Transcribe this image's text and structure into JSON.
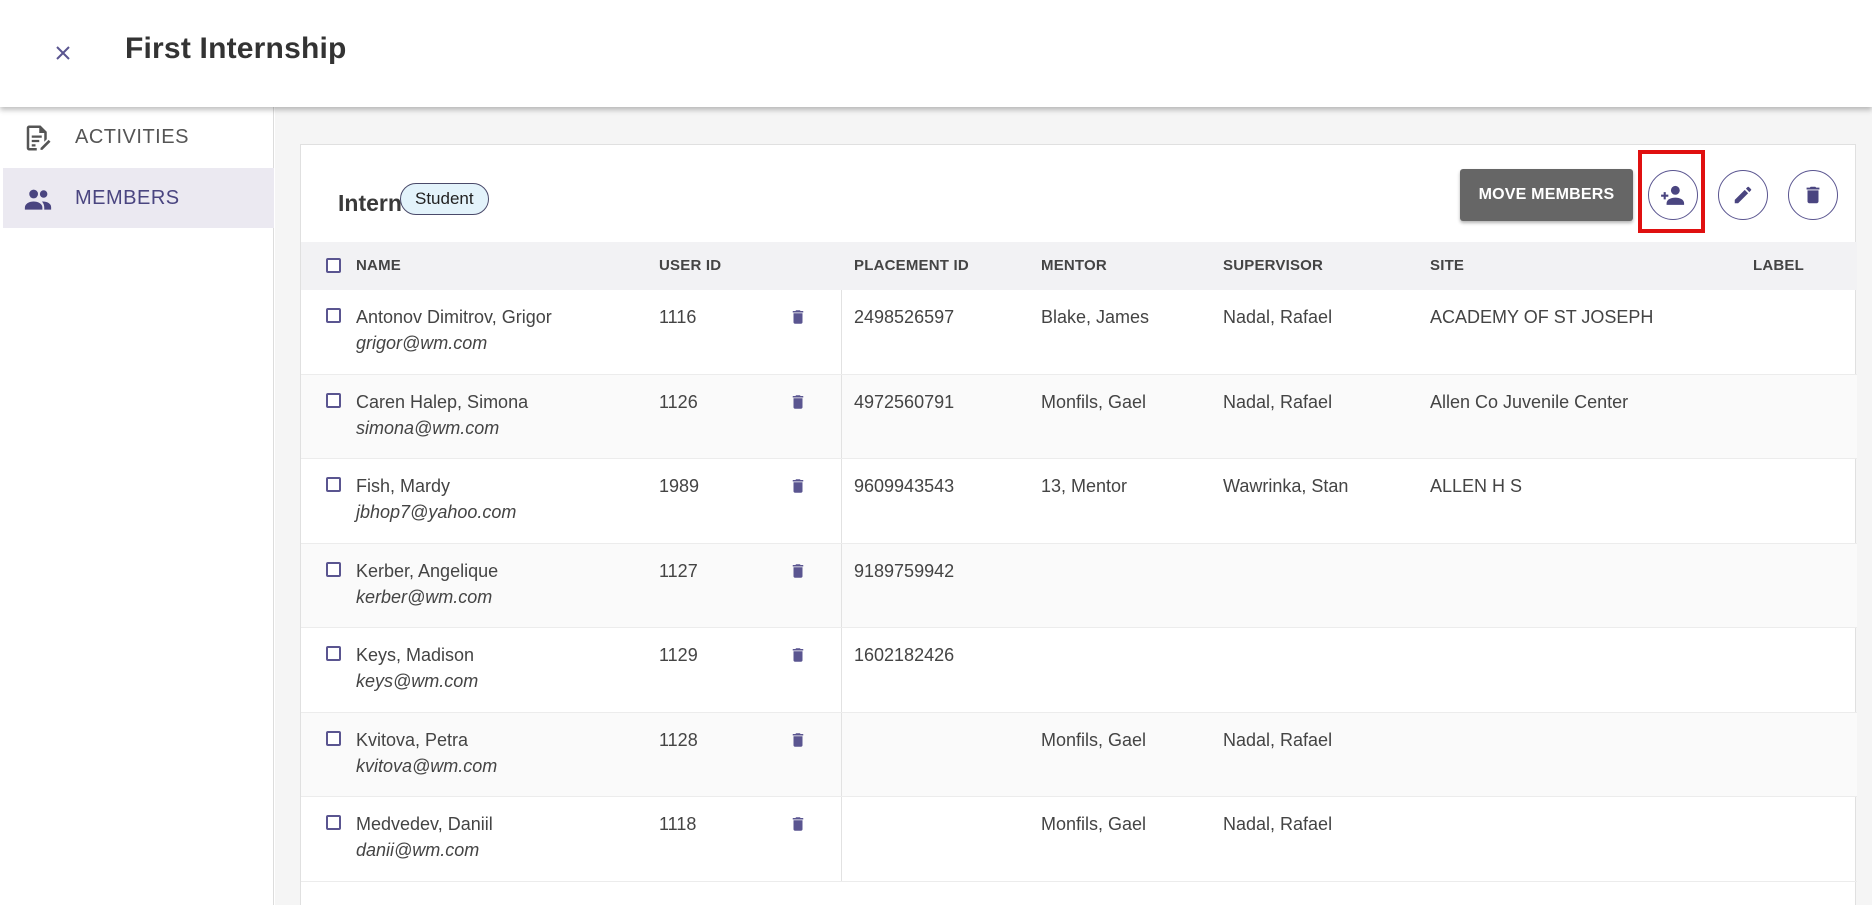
{
  "header": {
    "title": "First Internship",
    "close_icon": "close-icon"
  },
  "sidebar": {
    "items": [
      {
        "label": "ACTIVITIES",
        "icon": "edit-document-icon"
      },
      {
        "label": "MEMBERS",
        "icon": "people-icon",
        "active": true
      }
    ]
  },
  "group": {
    "title": "Intern",
    "role_chip": "Student",
    "move_button_label": "MOVE MEMBERS",
    "actions": [
      "add-member-icon",
      "edit-icon",
      "delete-icon"
    ]
  },
  "table": {
    "columns": [
      "NAME",
      "USER ID",
      "PLACEMENT ID",
      "MENTOR",
      "SUPERVISOR",
      "SITE",
      "LABEL"
    ],
    "rows": [
      {
        "name": "Antonov Dimitrov, Grigor",
        "email": "grigor@wm.com",
        "user_id": "1116",
        "placement_id": "2498526597",
        "mentor": "Blake, James",
        "supervisor": "Nadal, Rafael",
        "site": "ACADEMY OF ST JOSEPH",
        "label": ""
      },
      {
        "name": "Caren Halep, Simona",
        "email": "simona@wm.com",
        "user_id": "1126",
        "placement_id": "4972560791",
        "mentor": "Monfils, Gael",
        "supervisor": "Nadal, Rafael",
        "site": "Allen Co Juvenile Center",
        "label": ""
      },
      {
        "name": "Fish, Mardy",
        "email": "jbhop7@yahoo.com",
        "user_id": "1989",
        "placement_id": "9609943543",
        "mentor": "13, Mentor",
        "supervisor": "Wawrinka, Stan",
        "site": "ALLEN H S",
        "label": ""
      },
      {
        "name": "Kerber, Angelique",
        "email": "kerber@wm.com",
        "user_id": "1127",
        "placement_id": "9189759942",
        "mentor": "",
        "supervisor": "",
        "site": "",
        "label": ""
      },
      {
        "name": "Keys, Madison",
        "email": "keys@wm.com",
        "user_id": "1129",
        "placement_id": "1602182426",
        "mentor": "",
        "supervisor": "",
        "site": "",
        "label": ""
      },
      {
        "name": "Kvitova, Petra",
        "email": "kvitova@wm.com",
        "user_id": "1128",
        "placement_id": "",
        "mentor": "Monfils, Gael",
        "supervisor": "Nadal, Rafael",
        "site": "",
        "label": ""
      },
      {
        "name": "Medvedev, Daniil",
        "email": "danii@wm.com",
        "user_id": "1118",
        "placement_id": "",
        "mentor": "Monfils, Gael",
        "supervisor": "Nadal, Rafael",
        "site": "",
        "label": ""
      }
    ]
  },
  "colors": {
    "accent": "#5a5590",
    "active_nav_bg": "#ebe9f1",
    "chip_bg": "#e3f3fb",
    "move_button_bg": "#666666",
    "highlight": "#e01010"
  }
}
